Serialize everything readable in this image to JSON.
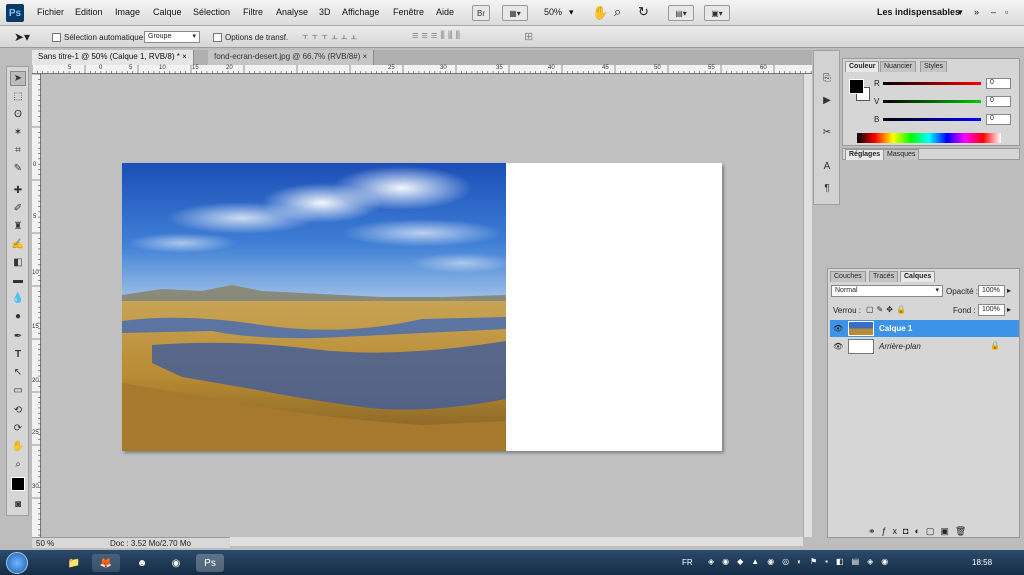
{
  "app": {
    "logo": "Ps"
  },
  "menu": [
    "Fichier",
    "Edition",
    "Image",
    "Calque",
    "Sélection",
    "Filtre",
    "Analyse",
    "3D",
    "Affichage",
    "Fenêtre",
    "Aide"
  ],
  "appbar": {
    "zoom": "50%",
    "workspace": "Les indispensables"
  },
  "options": {
    "auto_select_label": "Sélection automatique :",
    "auto_select_value": "Groupe",
    "transform_label": "Options de transf."
  },
  "tabs": [
    {
      "label": "Sans titre-1 @ 50% (Calque 1, RVB/8) *",
      "close": "×"
    },
    {
      "label": "fond-ecran-desert.jpg @ 66.7% (RVB/8#)",
      "close": "×"
    }
  ],
  "ruler_top": [
    "5",
    "0",
    "5",
    "10",
    "15",
    "20",
    "25",
    "30",
    "35",
    "40",
    "45",
    "50",
    "55",
    "60"
  ],
  "ruler_left": [
    "0",
    "5",
    "10",
    "15",
    "20",
    "25",
    "30"
  ],
  "status": {
    "zoom": "50 %",
    "doc": "Doc : 3.52 Mo/2.70 Mo"
  },
  "color_panel": {
    "tabs": [
      "Couleur",
      "Nuancier",
      "Styles"
    ],
    "channels": [
      {
        "label": "R",
        "value": "0"
      },
      {
        "label": "V",
        "value": "0"
      },
      {
        "label": "B",
        "value": "0"
      }
    ]
  },
  "adjust_panel": {
    "tabs": [
      "Réglages",
      "Masques"
    ]
  },
  "layers_panel": {
    "tabs": [
      "Couches",
      "Tracés",
      "Calques"
    ],
    "blend": "Normal",
    "opacity_label": "Opacité :",
    "opacity": "100%",
    "lock_label": "Verrou :",
    "fill_label": "Fond :",
    "fill": "100%",
    "layers": [
      {
        "name": "Calque 1",
        "selected": true
      },
      {
        "name": "Arrière-plan",
        "selected": false
      }
    ]
  },
  "taskbar": {
    "lang": "FR",
    "time": "18:58"
  },
  "colors": {
    "selection": "#3d93e8",
    "ps_blue": "#0c3a66"
  }
}
